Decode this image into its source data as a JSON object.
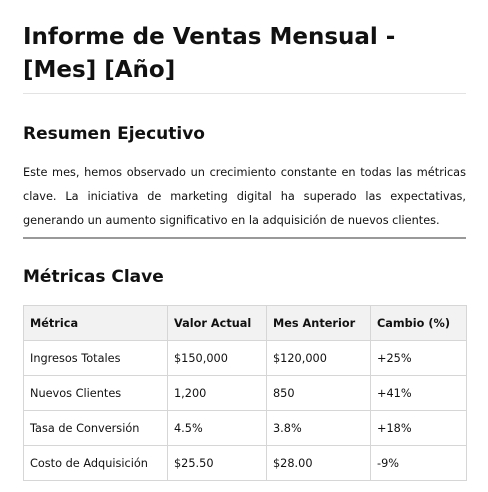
{
  "document": {
    "title_line1": "Informe de Ventas Mensual -",
    "title_line2": "[Mes] [Año]"
  },
  "summary": {
    "heading": "Resumen Ejecutivo",
    "text": "Este mes, hemos observado un crecimiento constante en todas las métricas clave. La iniciativa de marketing digital ha superado las expectativas, generando un aumento significativo en la adquisición de nuevos clientes."
  },
  "metrics": {
    "heading": "Métricas Clave",
    "columns": [
      "Métrica",
      "Valor Actual",
      "Mes Anterior",
      "Cambio (%)"
    ],
    "rows": [
      [
        "Ingresos Totales",
        "$150,000",
        "$120,000",
        "+25%"
      ],
      [
        "Nuevos Clientes",
        "1,200",
        "850",
        "+41%"
      ],
      [
        "Tasa de Conversión",
        "4.5%",
        "3.8%",
        "+18%"
      ],
      [
        "Costo de Adquisición",
        "$25.50",
        "$28.00",
        "-9%"
      ]
    ]
  }
}
